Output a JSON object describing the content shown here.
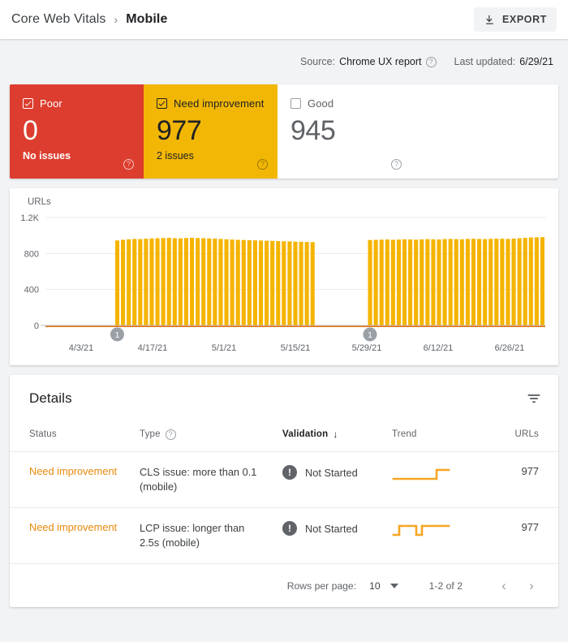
{
  "breadcrumb": {
    "root": "Core Web Vitals",
    "separator": "›",
    "current": "Mobile"
  },
  "toolbar": {
    "export_label": "EXPORT",
    "export_icon": "download-icon"
  },
  "meta": {
    "source_label": "Source:",
    "source_value": "Chrome UX report",
    "updated_label": "Last updated:",
    "updated_value": "6/29/21",
    "help_icon": "help-icon"
  },
  "status_cards": [
    {
      "id": "poor",
      "title": "Poor",
      "count": "0",
      "sub": "No issues",
      "checked": true,
      "bg": "#dc3d2e",
      "help_icon": "help-icon"
    },
    {
      "id": "need",
      "title": "Need improvement",
      "count": "977",
      "sub": "2 issues",
      "checked": true,
      "bg": "#f2b705",
      "help_icon": "help-icon"
    },
    {
      "id": "good",
      "title": "Good",
      "count": "945",
      "sub": "",
      "checked": false,
      "bg": "#ffffff",
      "help_icon": "help-icon"
    }
  ],
  "chart_data": {
    "type": "bar",
    "title": "",
    "ylabel": "URLs",
    "xlabel": "",
    "ylim": [
      0,
      1200
    ],
    "yticks": [
      0,
      400,
      800,
      1200
    ],
    "ytick_labels": [
      "0",
      "400",
      "800",
      "1.2K"
    ],
    "grid": true,
    "bar_color": "#f5b400",
    "baseline_color": "#e8710a",
    "legend": "none",
    "xtick_labels": [
      "4/3/21",
      "4/17/21",
      "5/1/21",
      "5/15/21",
      "5/29/21",
      "6/12/21",
      "6/26/21"
    ],
    "annotations": [
      {
        "label": "1",
        "x_date": "4/15/21"
      },
      {
        "label": "1",
        "x_date": "5/29/21"
      }
    ],
    "categories": [
      "4/3/21",
      "4/4/21",
      "4/5/21",
      "4/6/21",
      "4/7/21",
      "4/8/21",
      "4/9/21",
      "4/10/21",
      "4/11/21",
      "4/12/21",
      "4/13/21",
      "4/14/21",
      "4/15/21",
      "4/16/21",
      "4/17/21",
      "4/18/21",
      "4/19/21",
      "4/20/21",
      "4/21/21",
      "4/22/21",
      "4/23/21",
      "4/24/21",
      "4/25/21",
      "4/26/21",
      "4/27/21",
      "4/28/21",
      "4/29/21",
      "4/30/21",
      "5/1/21",
      "5/2/21",
      "5/3/21",
      "5/4/21",
      "5/5/21",
      "5/6/21",
      "5/7/21",
      "5/8/21",
      "5/9/21",
      "5/10/21",
      "5/11/21",
      "5/12/21",
      "5/13/21",
      "5/14/21",
      "5/15/21",
      "5/16/21",
      "5/17/21",
      "5/18/21",
      "5/19/21",
      "5/20/21",
      "5/21/21",
      "5/22/21",
      "5/23/21",
      "5/24/21",
      "5/25/21",
      "5/26/21",
      "5/27/21",
      "5/28/21",
      "5/29/21",
      "5/30/21",
      "5/31/21",
      "6/1/21",
      "6/2/21",
      "6/3/21",
      "6/4/21",
      "6/5/21",
      "6/6/21",
      "6/7/21",
      "6/8/21",
      "6/9/21",
      "6/10/21",
      "6/11/21",
      "6/12/21",
      "6/13/21",
      "6/14/21",
      "6/15/21",
      "6/16/21",
      "6/17/21",
      "6/18/21",
      "6/19/21",
      "6/20/21",
      "6/21/21",
      "6/22/21",
      "6/23/21",
      "6/24/21",
      "6/25/21",
      "6/26/21",
      "6/27/21",
      "6/28/21"
    ],
    "values": [
      null,
      null,
      null,
      null,
      null,
      null,
      null,
      null,
      null,
      null,
      null,
      null,
      945,
      952,
      958,
      962,
      960,
      965,
      968,
      970,
      972,
      974,
      970,
      968,
      972,
      975,
      972,
      970,
      968,
      966,
      962,
      958,
      955,
      952,
      950,
      948,
      946,
      944,
      942,
      940,
      938,
      936,
      934,
      932,
      930,
      928,
      926,
      null,
      null,
      null,
      null,
      null,
      null,
      null,
      null,
      null,
      950,
      952,
      954,
      956,
      953,
      955,
      958,
      956,
      954,
      957,
      960,
      958,
      956,
      960,
      962,
      960,
      958,
      962,
      964,
      962,
      960,
      963,
      965,
      964,
      962,
      966,
      970,
      974,
      978,
      980,
      982
    ]
  },
  "details": {
    "title": "Details",
    "filter_icon": "filter-icon",
    "columns": [
      {
        "key": "status",
        "label": "Status",
        "sorted": false,
        "help": false
      },
      {
        "key": "type",
        "label": "Type",
        "sorted": false,
        "help": true,
        "help_icon": "help-icon"
      },
      {
        "key": "validation",
        "label": "Validation",
        "sorted": true,
        "sort_arrow": "↓",
        "help": false
      },
      {
        "key": "trend",
        "label": "Trend",
        "sorted": false,
        "help": false
      },
      {
        "key": "urls",
        "label": "URLs",
        "sorted": false,
        "help": false
      }
    ],
    "rows": [
      {
        "status": "Need improvement",
        "type": "CLS issue: more than 0.1 (mobile)",
        "validation": "Not Started",
        "validation_icon": "alert-icon",
        "trend_icon": "sparkline-step-up",
        "urls": "977"
      },
      {
        "status": "Need improvement",
        "type": "LCP issue: longer than 2.5s (mobile)",
        "validation": "Not Started",
        "validation_icon": "alert-icon",
        "trend_icon": "sparkline-pulse",
        "urls": "977"
      }
    ],
    "pager": {
      "rows_label": "Rows per page:",
      "rows_value": "10",
      "range": "1-2 of 2",
      "prev_icon": "chevron-left-icon",
      "next_icon": "chevron-right-icon",
      "prev_glyph": "‹",
      "next_glyph": "›"
    }
  }
}
